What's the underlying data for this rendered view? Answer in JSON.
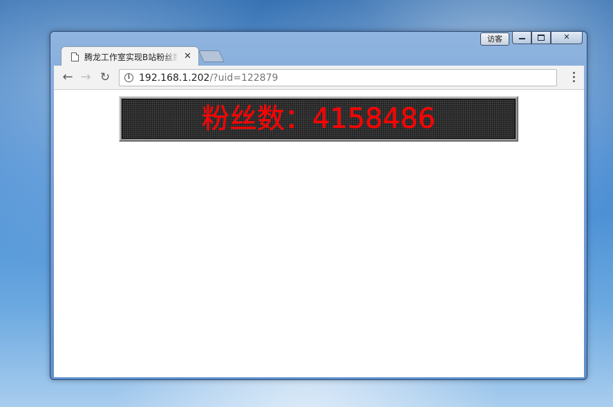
{
  "window": {
    "guest_label": "访客",
    "colors": {
      "frame": "#6f9bd2",
      "toolbar": "#f2f2f2"
    }
  },
  "tab": {
    "title": "腾龙工作室实现B站粉丝数显示",
    "close_glyph": "✕"
  },
  "omnibox": {
    "host": "192.168.1.202",
    "path": "/?uid=122879"
  },
  "icons": {
    "back": "arrow-left-icon",
    "forward": "arrow-right-icon",
    "reload": "reload-icon",
    "info": "info-icon",
    "menu": "kebab-menu-icon"
  },
  "led_display": {
    "label": "粉丝数",
    "separator": "：",
    "value": "4158486",
    "text_color": "#ff0000",
    "background_color": "#1b1b1b"
  }
}
